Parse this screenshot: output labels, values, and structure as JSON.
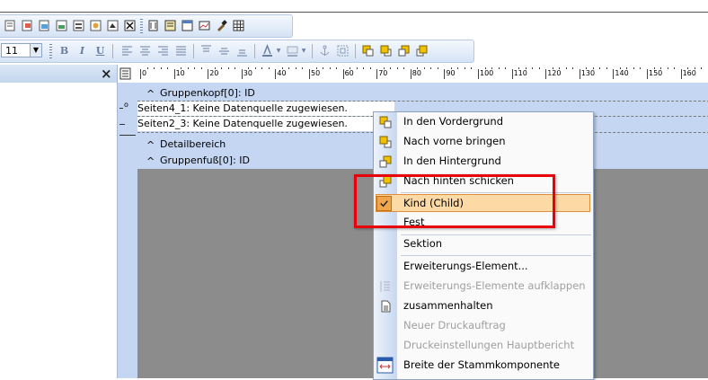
{
  "format_toolbar": {
    "font_size": "11",
    "bold": "B",
    "italic": "I",
    "underline": "U"
  },
  "left_panel": {
    "close": "×"
  },
  "ruler": {
    "labels": [
      "0",
      "10",
      "20",
      "30",
      "40",
      "50",
      "60",
      "70",
      "80",
      "90",
      "100",
      "110",
      "120",
      "130",
      "140",
      "150",
      "160"
    ]
  },
  "report": {
    "group_header": "Gruppenkopf[0]: ID",
    "row1_marker": "o",
    "row1": "Seiten4_1: Keine Datenquelle zugewiesen.",
    "row2": "Seiten2_3: Keine Datenquelle zugewiesen.",
    "detail": "Detailbereich",
    "group_footer": "Gruppenfuß[0]: ID",
    "caret": "^"
  },
  "context_menu": {
    "items": [
      {
        "label": "In  den  Vordergrund",
        "icon": "bring-to-front-icon",
        "disabled": false
      },
      {
        "label": "Nach vorne bringen",
        "icon": "bring-forward-icon",
        "disabled": false
      },
      {
        "label": "In den Hintergrund",
        "icon": "send-to-back-icon",
        "disabled": false
      },
      {
        "label": "Nach hinten schicken",
        "icon": "send-backward-icon",
        "disabled": false
      },
      {
        "label": "Kind (Child)",
        "icon": "check-icon",
        "disabled": false,
        "checked": true
      },
      {
        "label": "Fest",
        "disabled": false
      },
      {
        "label": "Sektion",
        "disabled": false
      },
      {
        "label": "Erweiterungs-Element...",
        "disabled": false
      },
      {
        "label": "Erweiterungs-Elemente aufklappen",
        "icon": "expand-elements-icon",
        "disabled": true
      },
      {
        "label": "zusammenhalten",
        "icon": "keep-together-icon",
        "disabled": false
      },
      {
        "label": "Neuer Druckauftrag",
        "disabled": true
      },
      {
        "label": "Druckeinstellungen Hauptbericht",
        "disabled": true
      },
      {
        "label": "Breite der Stammkomponente",
        "icon": "parent-width-icon",
        "disabled": false
      }
    ]
  },
  "colors": {
    "highlight": "#fcd9a5",
    "annotation_box": "#e8000b",
    "design_background": "#c4d6f2"
  }
}
